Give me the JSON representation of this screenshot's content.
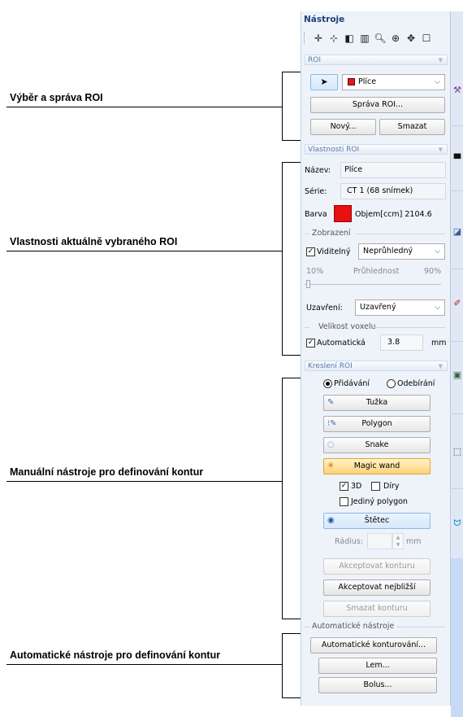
{
  "annotations": {
    "roi_selection": "Výběr a správa ROI",
    "roi_properties": "Vlastnosti aktuálně vybraného ROI",
    "manual_tools": "Manuální nástroje pro definování kontur",
    "auto_tools": "Automatické nástroje pro definování kontur"
  },
  "panel": {
    "title": "Nástroje",
    "toolbar_icons": [
      "crosshair-icon",
      "move-point-icon",
      "window-level-icon",
      "columns-icon",
      "zoom-icon",
      "zoom-region-icon",
      "pan-icon",
      "fullscreen-icon"
    ]
  },
  "roi": {
    "header": "ROI",
    "selected_roi": "Plíce",
    "roi_color": "#d81e1e",
    "manage_label": "Správa ROI...",
    "new_label": "Nový...",
    "delete_label": "Smazat"
  },
  "properties": {
    "header": "Vlastnosti ROI",
    "name_label": "Název:",
    "name_value": "Plíce",
    "series_label": "Série:",
    "series_value": "CT 1 (68 snímek)",
    "color_label": "Barva",
    "volume_label": "Objem[ccm]",
    "volume_value": "2104.6",
    "display_group": "Zobrazení",
    "visible_label": "Viditelný",
    "visible_checked": true,
    "opacity_mode": "Neprůhledný",
    "transparency_min": "10%",
    "transparency_label": "Průhlednost",
    "transparency_max": "90%",
    "closure_label": "Uzavření:",
    "closure_value": "Uzavřený",
    "voxel_group": "Velikost voxelu",
    "auto_label": "Automatická",
    "auto_checked": true,
    "voxel_value": "3.8",
    "voxel_unit": "mm"
  },
  "drawing": {
    "header": "Kreslení ROI",
    "add_label": "Přidávání",
    "remove_label": "Odebírání",
    "mode": "add",
    "pencil_label": "Tužka",
    "polygon_label": "Polygon",
    "snake_label": "Snake",
    "magic_wand_label": "Magic wand",
    "d3_label": "3D",
    "d3_checked": true,
    "holes_label": "Díry",
    "holes_checked": false,
    "single_polygon_label": "Jediný polygon",
    "single_polygon_checked": false,
    "brush_label": "Štětec",
    "radius_label": "Rádius:",
    "radius_unit": "mm",
    "accept_contour_label": "Akceptovat konturu",
    "accept_nearest_label": "Akceptovat nejbližší",
    "delete_contour_label": "Smazat konturu"
  },
  "auto": {
    "group_label": "Automatické nástroje",
    "auto_contouring_label": "Automatické konturování...",
    "margin_label": "Lem...",
    "bolus_label": "Bolus..."
  },
  "right_strip_icons": [
    "tools-icon",
    "layout-icon",
    "edit-icon",
    "brush-icon",
    "image-icon",
    "cube-icon",
    "contour-icon"
  ]
}
